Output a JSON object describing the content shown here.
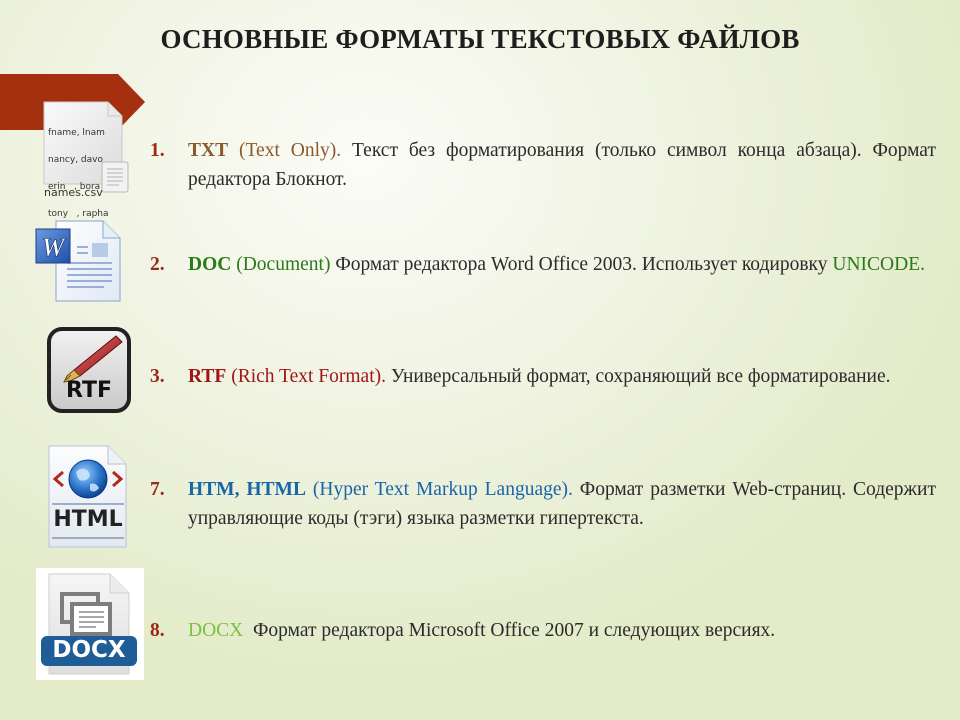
{
  "title": "ОСНОВНЫЕ ФОРМАТЫ ТЕКСТОВЫХ ФАЙЛОВ",
  "colors": {
    "banner": "#a5300f",
    "number": "#9b2a14",
    "txt": "#8a5a2e",
    "doc": "#2a7a1a",
    "rtf": "#a01616",
    "html": "#1a64a8",
    "docx": "#7bbf42"
  },
  "icons": {
    "csv": {
      "semantic": "csv-file-icon",
      "lines": [
        "fname, lnam",
        "nancy, davo",
        "erin   , bora",
        "tony   , rapha",
        "⋮"
      ],
      "filename": "names.csv"
    },
    "doc": {
      "semantic": "word-doc-icon",
      "letter": "W"
    },
    "rtf": {
      "semantic": "rtf-pen-icon",
      "label": "RTF"
    },
    "html": {
      "semantic": "html-globe-icon",
      "label": "HTML"
    },
    "docx": {
      "semantic": "docx-file-icon",
      "label": "DOCX"
    }
  },
  "items": [
    {
      "num": "1.",
      "kw": "TXT",
      "desc": " (Text Only).",
      "text": " Текст без форматирования (только символ конца абзаца). Формат редактора Блокнот."
    },
    {
      "num": "2.",
      "kw": "DOC",
      "desc": " (Document)",
      "text": " Формат редактора Word Office 2003. Использует кодировку ",
      "extra": "UNICODE."
    },
    {
      "num": "3.",
      "kw": "RTF",
      "desc": " (Rich Text Format).",
      "text": " Универсальный формат, сохраняющий все форматирование."
    },
    {
      "num": "7.",
      "kw": "HTM, HTML",
      "desc": " (Hyper Text Markup Language).",
      "text": " Формат разметки Web-страниц. Содержит управляющие коды (тэги) языка разметки гипертекста."
    },
    {
      "num": "8.",
      "kw": "DOCX",
      "desc": "",
      "text": "  Формат редактора Microsoft Office 2007 и следующих версиях."
    }
  ]
}
